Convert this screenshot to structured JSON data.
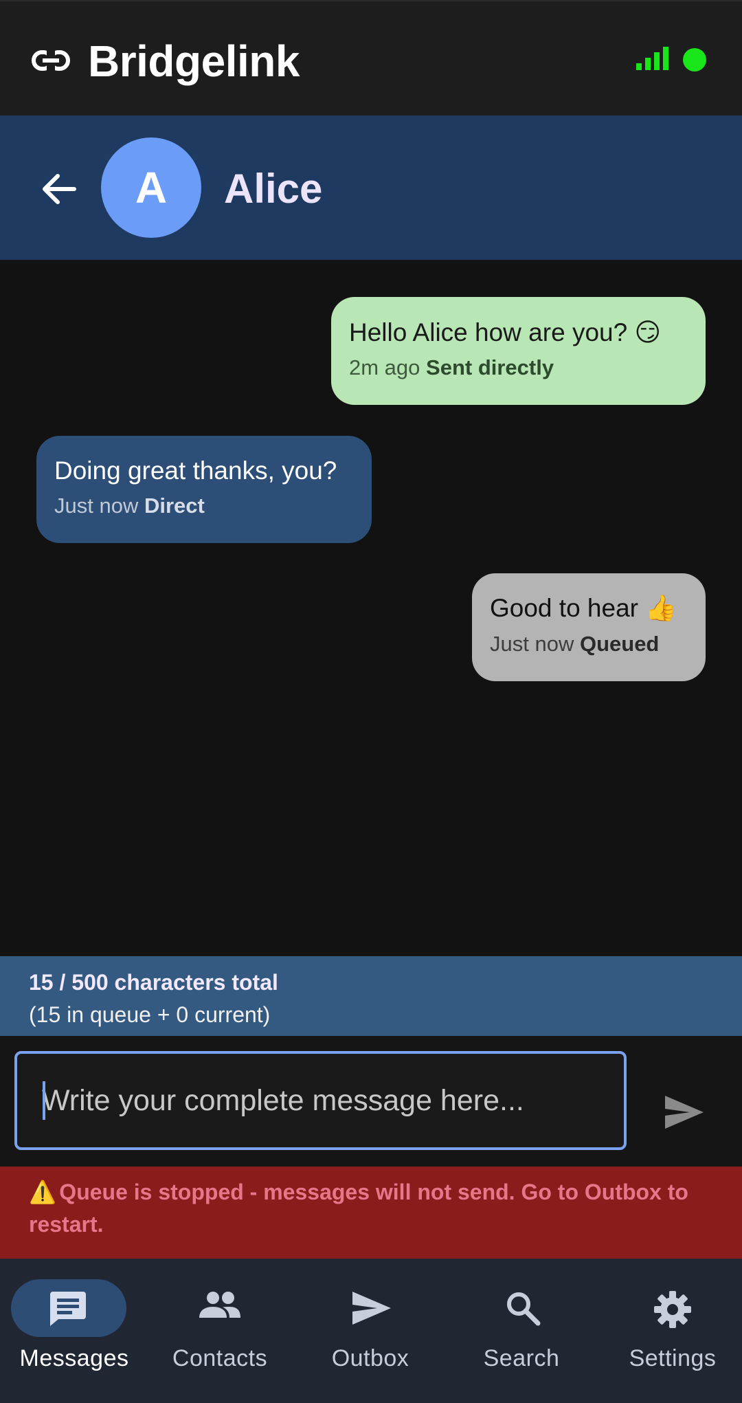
{
  "app": {
    "title": "Bridgelink"
  },
  "conversation": {
    "contact_initial": "A",
    "contact_name": "Alice"
  },
  "messages": [
    {
      "text": "Hello Alice how are you? 😏",
      "time": "2m ago",
      "status": "Sent directly",
      "direction": "outgoing"
    },
    {
      "text": "Doing great thanks, you?",
      "time": "Just now",
      "status": "Direct",
      "direction": "incoming"
    },
    {
      "text": "Good to hear 👍",
      "time": "Just now",
      "status": "Queued",
      "direction": "outgoing"
    }
  ],
  "counter": {
    "total": "15 / 500 characters total",
    "detail": "(15 in queue + 0 current)"
  },
  "compose": {
    "placeholder": "Write your complete message here..."
  },
  "warning": {
    "icon": "⚠️",
    "text": "Queue is stopped - messages will not send. Go to Outbox to restart."
  },
  "nav": {
    "items": [
      {
        "label": "Messages",
        "icon": "message-icon",
        "active": true
      },
      {
        "label": "Contacts",
        "icon": "people-icon",
        "active": false
      },
      {
        "label": "Outbox",
        "icon": "send-icon",
        "active": false
      },
      {
        "label": "Search",
        "icon": "search-icon",
        "active": false
      },
      {
        "label": "Settings",
        "icon": "gear-icon",
        "active": false
      }
    ]
  },
  "colors": {
    "accent": "#6b9cf7",
    "status_online": "#19e619",
    "warning_bg": "#8b1c1c"
  }
}
